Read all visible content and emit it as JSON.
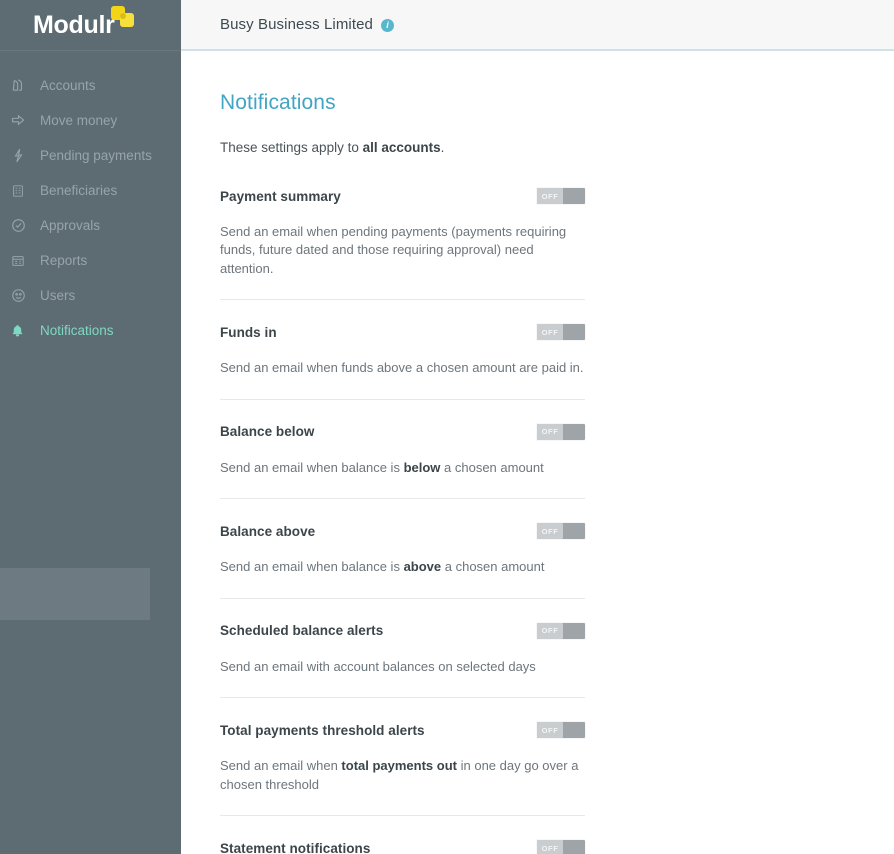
{
  "brand": {
    "name": "Modulr",
    "logo_icon": "modulr-squares-logo",
    "accent_yellow": "#f3d417",
    "sidebar_bg": "#5d6b73",
    "active_color": "#7fd8c2"
  },
  "sidebar": {
    "items": [
      {
        "label": "Accounts",
        "icon": "accounts-icon",
        "active": false
      },
      {
        "label": "Move money",
        "icon": "arrow-right-icon",
        "active": false
      },
      {
        "label": "Pending payments",
        "icon": "lightning-bolt-icon",
        "active": false
      },
      {
        "label": "Beneficiaries",
        "icon": "building-icon",
        "active": false
      },
      {
        "label": "Approvals",
        "icon": "check-circle-icon",
        "active": false
      },
      {
        "label": "Reports",
        "icon": "calendar-report-icon",
        "active": false
      },
      {
        "label": "Users",
        "icon": "users-icon",
        "active": false
      },
      {
        "label": "Notifications",
        "icon": "bell-icon",
        "active": true
      }
    ]
  },
  "topbar": {
    "organisation": "Busy Business Limited",
    "info_icon": "info-circle-icon",
    "info_glyph": "i"
  },
  "page": {
    "title": "Notifications",
    "title_color": "#43a5c4",
    "intro_prefix": "These settings apply to ",
    "intro_bold": "all accounts",
    "intro_suffix": "."
  },
  "toggle": {
    "off_label": "OFF",
    "track_color": "#9ea4a8",
    "knob_color": "#c9cdd0"
  },
  "settings": [
    {
      "title": "Payment summary",
      "state": "OFF",
      "desc_parts": [
        {
          "text": "Send an email when pending payments (payments requiring funds, future dated and those requiring approval) need attention.",
          "bold": false
        }
      ]
    },
    {
      "title": "Funds in",
      "state": "OFF",
      "desc_parts": [
        {
          "text": "Send an email when funds above a chosen amount are paid in.",
          "bold": false
        }
      ]
    },
    {
      "title": "Balance below",
      "state": "OFF",
      "desc_parts": [
        {
          "text": "Send an email when balance is ",
          "bold": false
        },
        {
          "text": "below",
          "bold": true
        },
        {
          "text": " a chosen amount",
          "bold": false
        }
      ]
    },
    {
      "title": "Balance above",
      "state": "OFF",
      "desc_parts": [
        {
          "text": "Send an email when balance is ",
          "bold": false
        },
        {
          "text": "above",
          "bold": true
        },
        {
          "text": " a chosen amount",
          "bold": false
        }
      ]
    },
    {
      "title": "Scheduled balance alerts",
      "state": "OFF",
      "desc_parts": [
        {
          "text": " Send an email with account balances on selected days",
          "bold": false
        }
      ]
    },
    {
      "title": "Total payments threshold alerts",
      "state": "OFF",
      "desc_parts": [
        {
          "text": "Send an email when ",
          "bold": false
        },
        {
          "text": "total payments out",
          "bold": true
        },
        {
          "text": " in one day go over a chosen threshold",
          "bold": false
        }
      ]
    },
    {
      "title": "Statement notifications",
      "state": "OFF",
      "desc_parts": [],
      "cut_off": true
    }
  ]
}
